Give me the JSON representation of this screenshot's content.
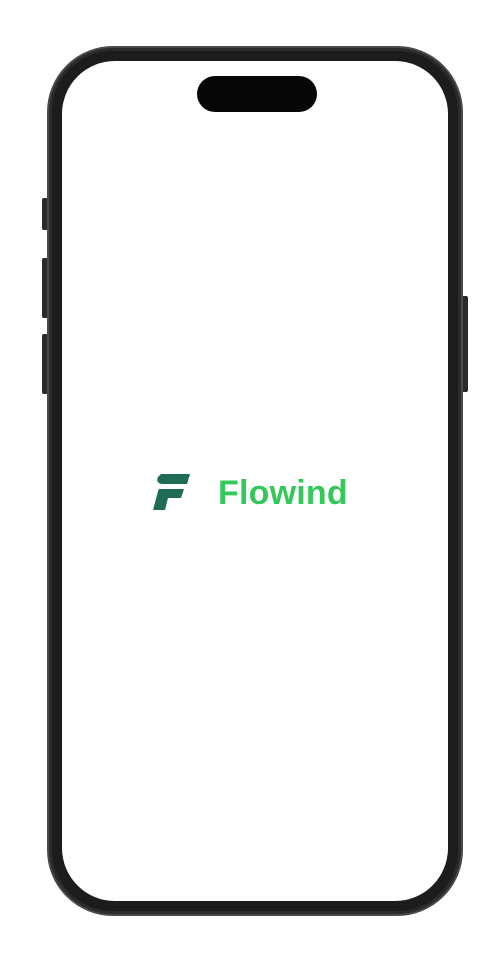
{
  "app": {
    "brand_name": "Flowind",
    "logo_icon": "flowind-logo-icon"
  },
  "colors": {
    "brand_text": "#34c759",
    "logo_mark": "#1f6b55",
    "background": "#ffffff",
    "device_frame": "#1c1c1c"
  }
}
